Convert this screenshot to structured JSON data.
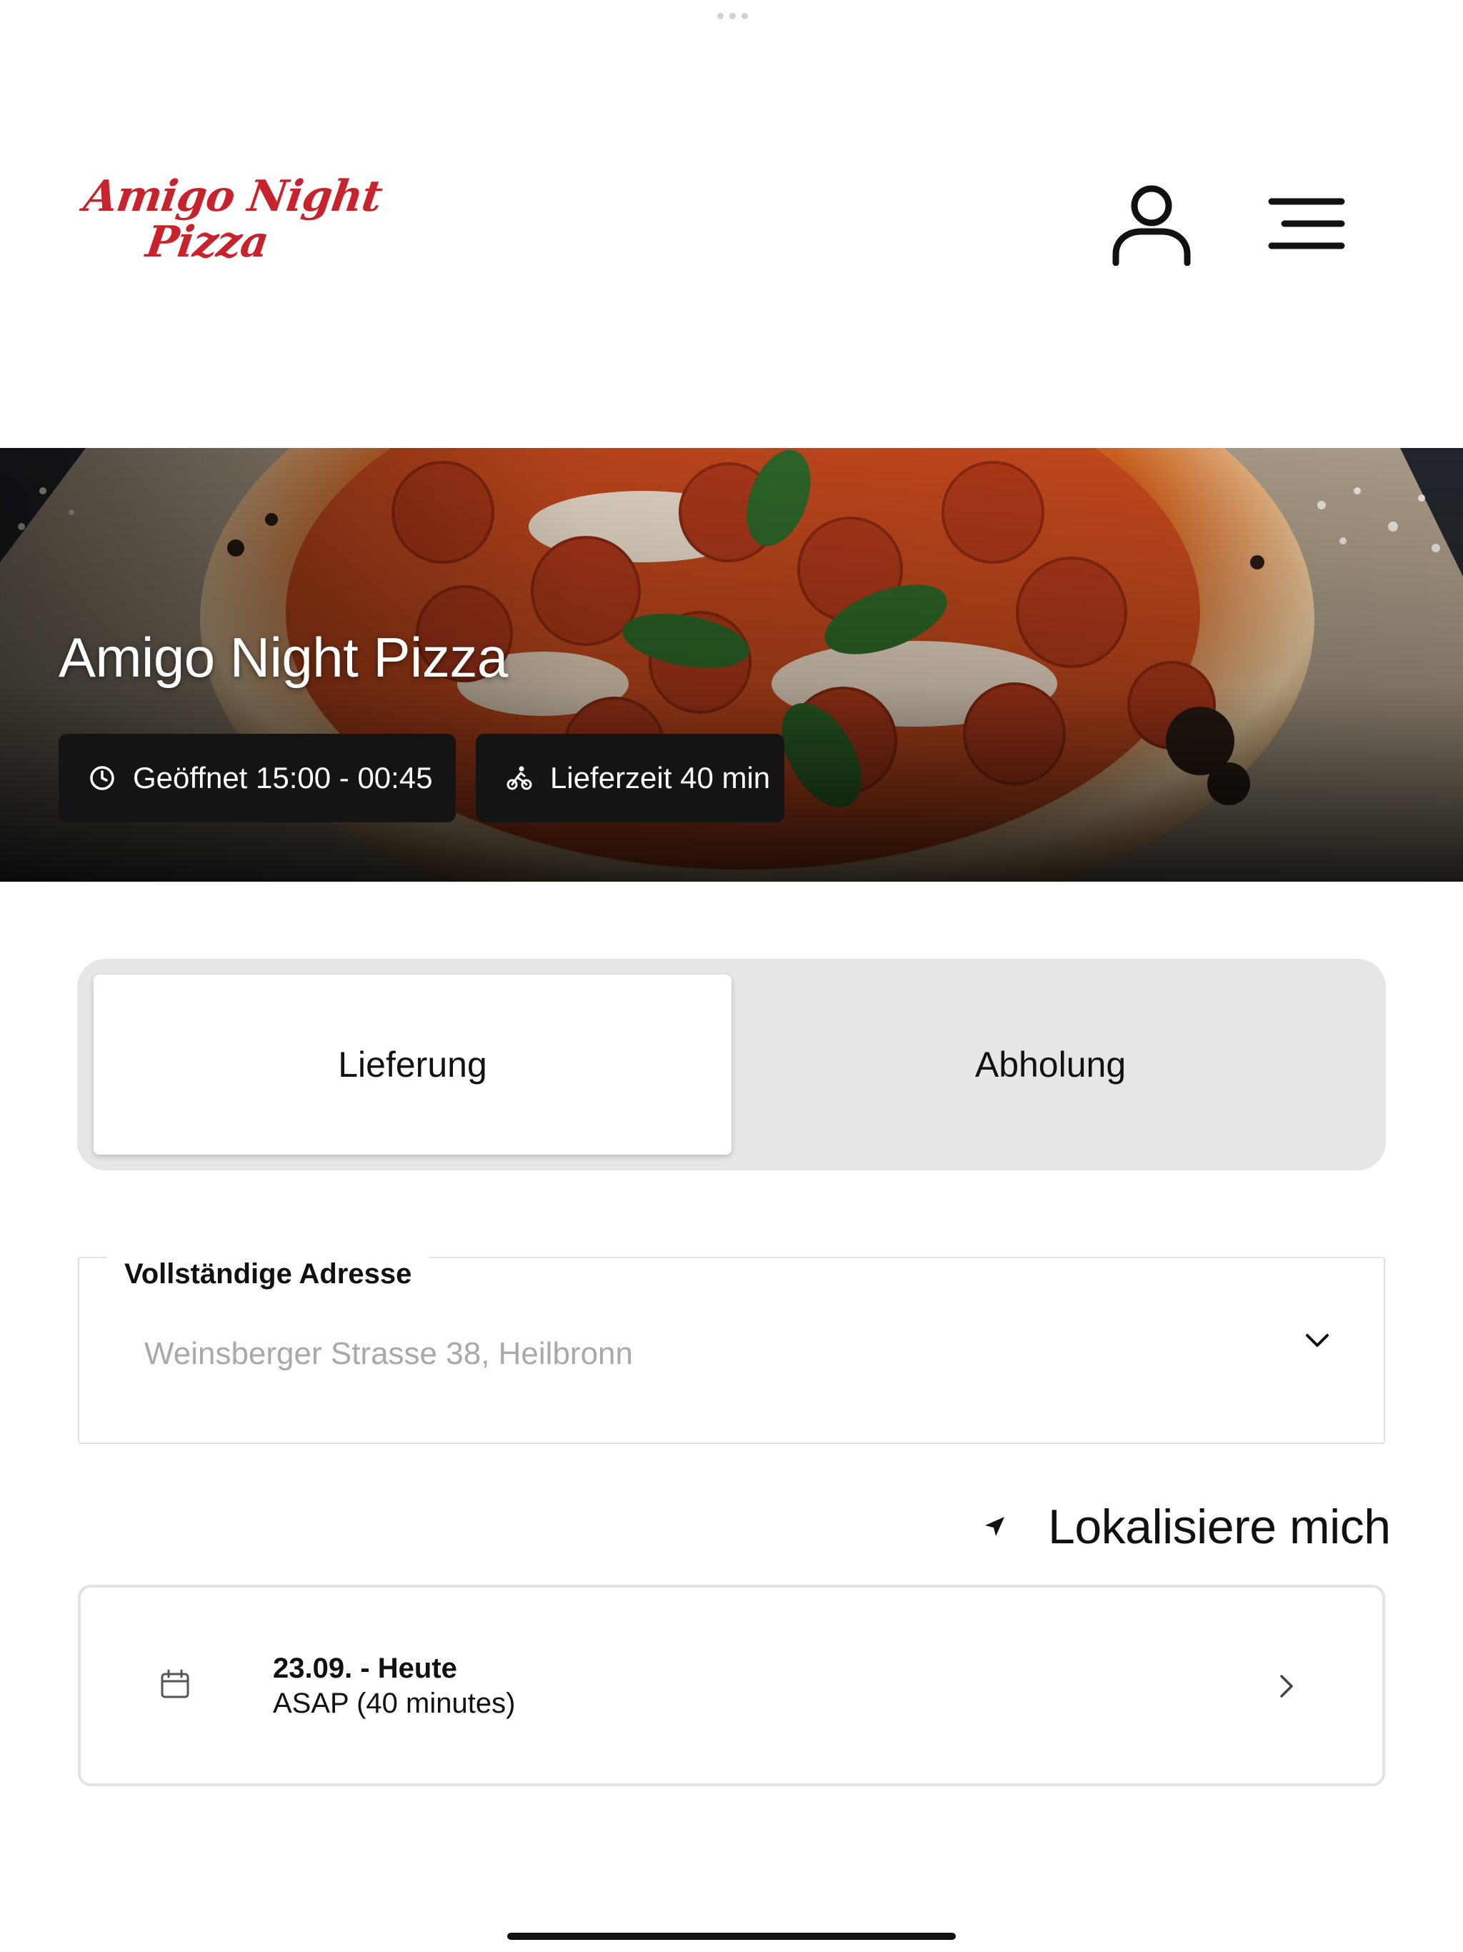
{
  "header": {
    "logo_line1": "Amigo Night",
    "logo_line2": "Pizza",
    "icons": {
      "account": "user-icon",
      "menu": "hamburger-menu-icon"
    }
  },
  "hero": {
    "title": "Amigo Night Pizza",
    "opening_hours": "Geöffnet 15:00 - 00:45",
    "delivery_time": "Lieferzeit 40 min",
    "icons": {
      "opening_hours": "clock-icon",
      "delivery_time": "bicycle-icon"
    }
  },
  "order_type": {
    "options": [
      {
        "label": "Lieferung",
        "selected": true
      },
      {
        "label": "Abholung",
        "selected": false
      }
    ]
  },
  "address": {
    "label": "Vollständige Adresse",
    "placeholder": "Weinsberger Strasse 38, Heilbronn",
    "icon": "chevron-down-icon"
  },
  "locate": {
    "label": "Lokalisiere mich",
    "icon": "location-arrow-icon"
  },
  "schedule": {
    "date": "23.09. - Heute",
    "time": "ASAP (40 minutes)",
    "icons": {
      "calendar": "calendar-icon",
      "arrow": "chevron-right-icon"
    }
  },
  "colors": {
    "brand": "#c8232c",
    "toggle_bg": "#e6e6e6",
    "chip_bg": "#141414",
    "placeholder": "#a9a9a9"
  }
}
